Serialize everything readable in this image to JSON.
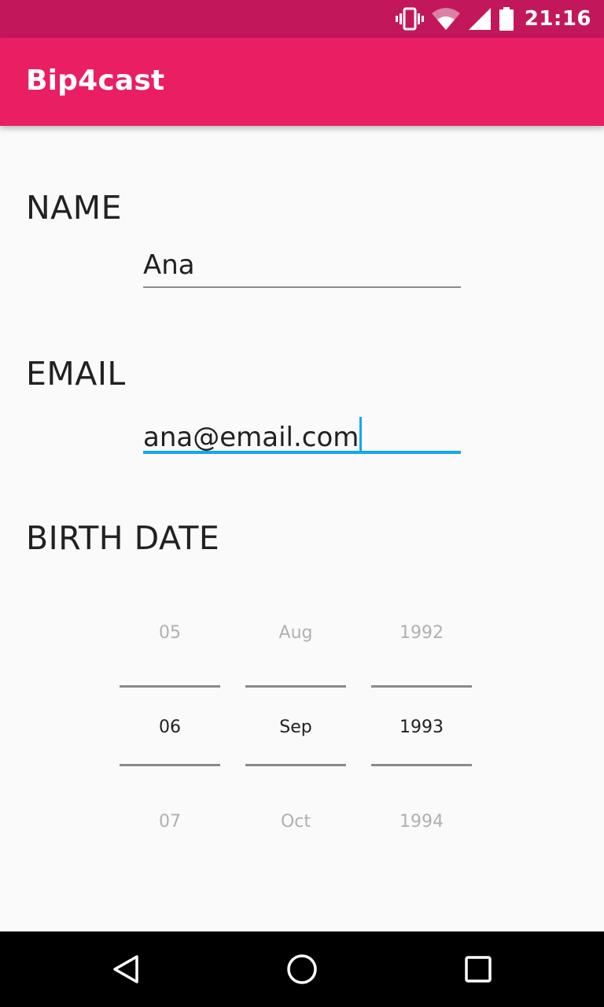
{
  "status_bar": {
    "time": "21:16",
    "icons": [
      "vibrate-icon",
      "wifi-icon",
      "signal-icon",
      "battery-icon"
    ]
  },
  "app_bar": {
    "title": "Bip4cast"
  },
  "form": {
    "name": {
      "label": "NAME",
      "value": "Ana"
    },
    "email": {
      "label": "EMAIL",
      "value": "ana@email.com"
    },
    "birth_date": {
      "label": "BIRTH DATE",
      "day": {
        "prev": "05",
        "selected": "06",
        "next": "07"
      },
      "month": {
        "prev": "Aug",
        "selected": "Sep",
        "next": "Oct"
      },
      "year": {
        "prev": "1992",
        "selected": "1993",
        "next": "1994"
      }
    }
  },
  "nav_bar": {
    "buttons": [
      "back-icon",
      "home-icon",
      "recents-icon"
    ]
  },
  "colors": {
    "status_bar": "#c2185b",
    "app_bar": "#e91e63",
    "accent": "#12a9ec",
    "background": "#fafafa"
  }
}
